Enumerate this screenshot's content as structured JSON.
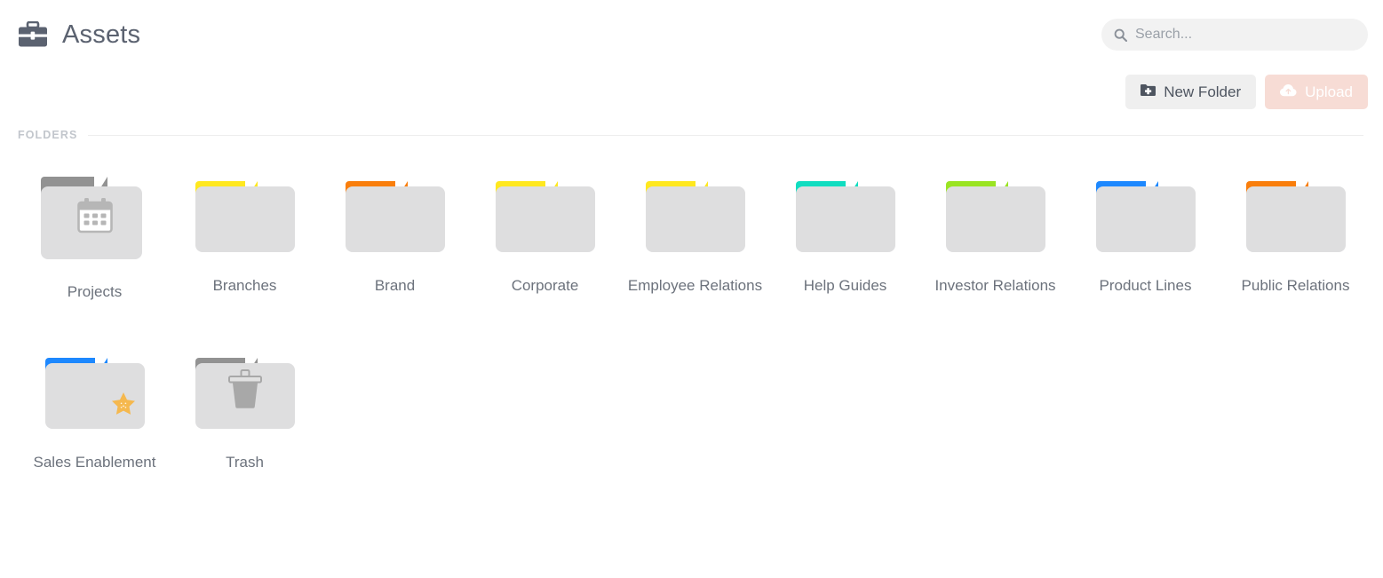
{
  "header": {
    "title": "Assets",
    "logo_icon": "briefcase-icon"
  },
  "search": {
    "placeholder": "Search...",
    "value": "",
    "icon": "search-icon"
  },
  "toolbar": {
    "new_folder_label": "New Folder",
    "new_folder_icon": "folder-plus-icon",
    "upload_label": "Upload",
    "upload_icon": "cloud-upload-icon",
    "upload_disabled_color": "#f7dcd5"
  },
  "section": {
    "label": "FOLDERS"
  },
  "folders": [
    {
      "label": "Projects",
      "tab_color": "#929292",
      "overlay_icon": "calendar-icon",
      "badge": "",
      "variant": "big"
    },
    {
      "label": "Branches",
      "tab_color": "#ffe81f",
      "overlay_icon": "",
      "badge": "",
      "variant": "normal"
    },
    {
      "label": "Brand",
      "tab_color": "#f97e0c",
      "overlay_icon": "",
      "badge": "",
      "variant": "normal"
    },
    {
      "label": "Corporate",
      "tab_color": "#ffe81f",
      "overlay_icon": "",
      "badge": "",
      "variant": "normal"
    },
    {
      "label": "Employee Relations",
      "tab_color": "#ffe81f",
      "overlay_icon": "",
      "badge": "",
      "variant": "normal"
    },
    {
      "label": "Help Guides",
      "tab_color": "#11ddc0",
      "overlay_icon": "",
      "badge": "",
      "variant": "normal"
    },
    {
      "label": "Investor Relations",
      "tab_color": "#9ae422",
      "overlay_icon": "",
      "badge": "",
      "variant": "normal"
    },
    {
      "label": "Product Lines",
      "tab_color": "#1d88fe",
      "overlay_icon": "",
      "badge": "",
      "variant": "normal"
    },
    {
      "label": "Public Relations",
      "tab_color": "#f97e0c",
      "overlay_icon": "",
      "badge": "",
      "variant": "normal"
    },
    {
      "label": "Sales Enablement",
      "tab_color": "#1d88fe",
      "overlay_icon": "",
      "badge": "star-badge-icon",
      "variant": "normal"
    },
    {
      "label": "Trash",
      "tab_color": "#929292",
      "overlay_icon": "trash-icon",
      "badge": "",
      "variant": "normal"
    }
  ]
}
